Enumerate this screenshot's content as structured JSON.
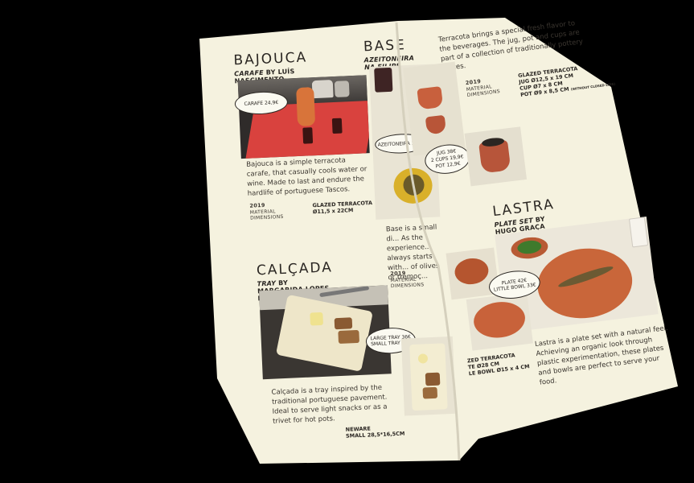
{
  "catalog": {
    "bajouca": {
      "title": "BAJOUCA",
      "subtitle_item": "CARAFE",
      "subtitle_by": "BY LUÍS NASCIMENTO",
      "price_tag": "CARAFE 24,9€",
      "description": "Bajouca is a simple terracota carafe, that casually cools water or wine. Made to last and endure the hardlife of portuguese Tascos.",
      "year": "2019",
      "label_material": "MATERIAL",
      "label_dimensions": "DIMENSIONS",
      "material": "GLAZED TERRACOTA",
      "dimensions": "Ø11,5 x 22CM"
    },
    "calcada": {
      "title": "CALÇADA",
      "subtitle_item": "TRAY",
      "subtitle_by": "BY MARGARIDA LOPES PEREIRA",
      "tag_large": "LARGE TRAY 36€",
      "tag_small": "SMALL TRAY 38€",
      "description": "Calçada is a tray inspired by the traditional portuguese pavement. Ideal to serve light snacks or as a trivet for hot pots.",
      "material": "NEWARE",
      "dimensions": "SMALL 28,5*16,5CM"
    },
    "base": {
      "title": "BASE",
      "subtitle": "AZEITONEIRA NA FILIPE",
      "tag_azeitoneira": "AZEITONEIRA 14,9€",
      "tag_jug": "JUG 38€",
      "tag_cups": "2 CUPS 19,9€",
      "tag_pot": "POT 12,9€",
      "description": "Base is a small di... As the experience... always starts with... of olives or tremoç...",
      "year": "2019",
      "label_material": "MATERIAL",
      "label_dimensions": "DIMENSIONS",
      "intro": "Terracota brings a special fresh flavor to the beverages. The jug, pot and cups are part of a collection of traditionally pottery pieces.",
      "material": "GLAZED TERRACOTA",
      "dims_jug": "JUG Ø12,5 x 19 CM",
      "dims_cup": "CUP Ø7 x 8 CM",
      "dims_pot": "POT Ø9 x 8,5 CM",
      "dims_note": "(WITHOUT CLOSED LIDS)"
    },
    "lastra": {
      "title": "LASTRA",
      "subtitle_item": "PLATE SET",
      "subtitle_by": "BY HUGO GRAÇA",
      "tag_plate": "PLATE 42€",
      "tag_bowl": "LITTLE BOWL 33€",
      "description": "Lastra is a plate set with a natural feel. Achieving an organic look through plastic experimentation, these plates and bowls are perfect to serve your food.",
      "material": "ZED TERRACOTA",
      "dims_plate": "TE Ø28 CM",
      "dims_bowl": "LE BOWL Ø15 x 4 CM"
    }
  },
  "colors": {
    "paper": "#f5f2df",
    "terracotta": "#c9663a",
    "red_mat": "#d9423e",
    "ink": "#2a2622"
  }
}
